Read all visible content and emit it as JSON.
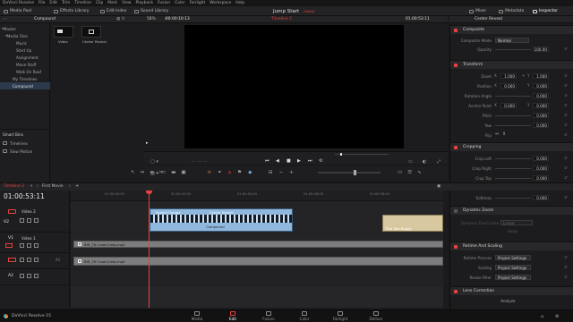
{
  "menu": [
    "DaVinci Resolve",
    "File",
    "Edit",
    "Trim",
    "Timeline",
    "Clip",
    "Mark",
    "View",
    "Playback",
    "Fusion",
    "Color",
    "Fairlight",
    "Workspace",
    "Help"
  ],
  "toolbar": {
    "media_pool": "Media Pool",
    "effects_library": "Effects Library",
    "edit_index": "Edit Index",
    "sound_library": "Sound Library",
    "project_title": "Jump Start",
    "edited_badge": "Edited",
    "mixer": "Mixer",
    "metadata": "Metadata",
    "inspector": "Inspector"
  },
  "media_pool": {
    "bin_title": "Compound",
    "master_label": "Master",
    "bins": [
      "Master",
      "Media Files",
      "Music",
      "Start Up",
      "Assignment",
      "Move Stuff",
      "Walk On Roof",
      "My Timelines",
      "Compound"
    ],
    "clips": [
      "Video",
      "Center Reveal"
    ],
    "smart_bins_label": "Smart Bins",
    "smart_bins": [
      "Timelines",
      "Slow Motion"
    ]
  },
  "viewer": {
    "zoom": "58%",
    "source_timecode": "00:00:10:13",
    "timeline_name": "Timeline 2",
    "record_timecode": "01:00:53:11"
  },
  "inspector": {
    "clip_name": "Center Reveal",
    "sections": {
      "composite": "Composite",
      "transform": "Transform",
      "cropping": "Cropping",
      "dynamic_zoom": "Dynamic Zoom",
      "retime_scaling": "Retime And Scaling",
      "lens_correction": "Lens Correction"
    },
    "composite_mode_label": "Composite Mode",
    "composite_mode": "Normal",
    "opacity_label": "Opacity",
    "opacity": "100.00",
    "transform_rows": [
      {
        "label": "Zoom",
        "x": "1.000",
        "y": "1.000"
      },
      {
        "label": "Position",
        "x": "0.000",
        "y": "0.000"
      },
      {
        "label": "Rotation Angle",
        "x": "",
        "y": "0.000"
      },
      {
        "label": "Anchor Point",
        "x": "0.000",
        "y": "0.000"
      },
      {
        "label": "Pitch",
        "x": "",
        "y": "0.000"
      },
      {
        "label": "Yaw",
        "x": "",
        "y": "0.000"
      },
      {
        "label": "Flip",
        "x": "",
        "y": ""
      }
    ],
    "cropping_rows": [
      {
        "label": "Crop Left",
        "value": "0.000"
      },
      {
        "label": "Crop Right",
        "value": "0.000"
      },
      {
        "label": "Crop Top",
        "value": "0.000"
      },
      {
        "label": "Crop Bottom",
        "value": "0.000"
      },
      {
        "label": "Softness",
        "value": "0.000"
      }
    ],
    "dynamic_zoom_label": "Dynamic Zoom Ease",
    "dynamic_zoom_value": "Linear",
    "swap_label": "Swap",
    "retime_rows": [
      {
        "label": "Retime Process",
        "value": "Project Settings"
      },
      {
        "label": "Scaling",
        "value": "Project Settings"
      },
      {
        "label": "Resize Filter",
        "value": "Project Settings"
      }
    ],
    "analyze_label": "Analyze"
  },
  "timeline": {
    "name": "Timeline 2",
    "bin_name": "First Movie",
    "timecode": "01:00:53:11",
    "ruler_ticks": [
      "01:00:50:00",
      "01:00:52:00",
      "01:00:54:00",
      "01:00:56:00",
      "01:00:58:00"
    ],
    "tracks": [
      {
        "id": "V2",
        "name": "Video 2"
      },
      {
        "id": "V1",
        "name": "Video 1"
      },
      {
        "id": "A1",
        "name": ""
      },
      {
        "id": "A2",
        "name": ""
      }
    ],
    "clips": {
      "compound_title": "Speed Change",
      "compound_effect": "Center Reveal",
      "compound_sub": "Compound",
      "title_clip": "Title Two Buggy",
      "v1_clip": "BIR_78 Crawl Jump.mp4",
      "a1_clip": "BIR_78 Crawl Jump.mp4"
    }
  },
  "pages": [
    "Media",
    "Edit",
    "Fusion",
    "Color",
    "Fairlight",
    "Deliver"
  ],
  "active_page": "Edit",
  "app_name": "DaVinci Resolve 15",
  "colors": {
    "accent": "#e8423c",
    "clip_blue": "#8fb8dc",
    "clip_gold": "#d8c8a0",
    "track_gray": "#7d7d7f"
  }
}
